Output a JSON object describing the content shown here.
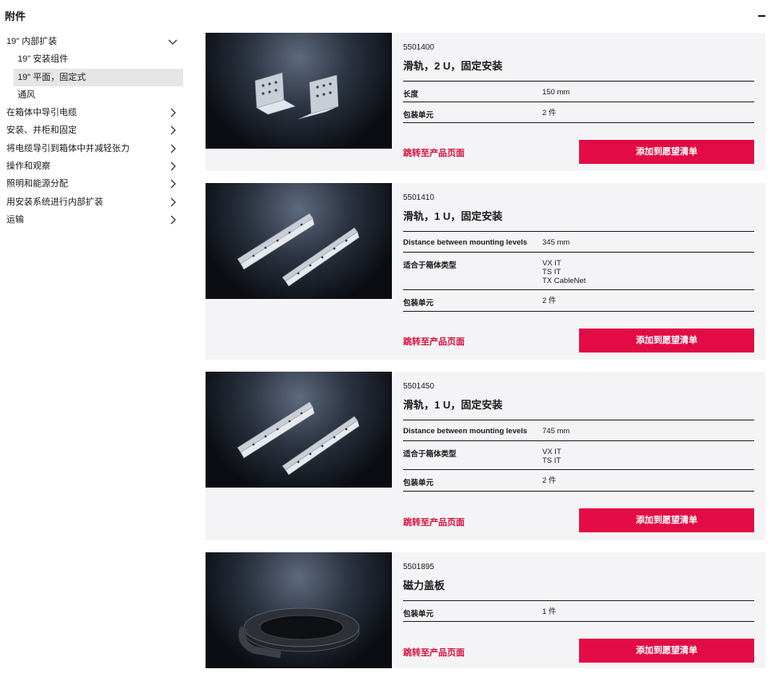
{
  "header": {
    "title": "附件"
  },
  "sidebar": {
    "items": [
      {
        "label": "19\" 内部扩装"
      },
      {
        "label": "19\" 安装组件"
      },
      {
        "label": "19\" 平面，固定式"
      },
      {
        "label": "通风"
      },
      {
        "label": "在箱体中导引电缆"
      },
      {
        "label": "安装、并柜和固定"
      },
      {
        "label": "将电缆导引到箱体中并减轻张力"
      },
      {
        "label": "操作和观察"
      },
      {
        "label": "照明和能源分配"
      },
      {
        "label": "用安装系统进行内部扩装"
      },
      {
        "label": "运输"
      }
    ]
  },
  "products": [
    {
      "sku": "5501400",
      "title": "滑轨，2 U，固定安装",
      "specs": [
        {
          "label": "长度",
          "value": "150 mm"
        },
        {
          "label": "包装单元",
          "value": "2 件"
        }
      ],
      "link": "跳转至产品页面",
      "button": "添加到愿望清单"
    },
    {
      "sku": "5501410",
      "title": "滑轨，1 U，固定安装",
      "specs": [
        {
          "label": "Distance between mounting levels",
          "value": "345 mm"
        },
        {
          "label": "适合于箱体类型",
          "value": "VX IT\nTS IT\nTX CableNet"
        },
        {
          "label": "包装单元",
          "value": "2 件"
        }
      ],
      "link": "跳转至产品页面",
      "button": "添加到愿望清单"
    },
    {
      "sku": "5501450",
      "title": "滑轨，1 U，固定安装",
      "specs": [
        {
          "label": "Distance between mounting levels",
          "value": "745 mm"
        },
        {
          "label": "适合于箱体类型",
          "value": "VX IT\nTS IT"
        },
        {
          "label": "包装单元",
          "value": "2 件"
        }
      ],
      "link": "跳转至产品页面",
      "button": "添加到愿望清单"
    },
    {
      "sku": "5501895",
      "title": "磁力盖板",
      "specs": [
        {
          "label": "包装单元",
          "value": "1 件"
        }
      ],
      "link": "跳转至产品页面",
      "button": "添加到愿望清单"
    }
  ],
  "colors": {
    "accent": "#e30b45",
    "link": "#d80f3d",
    "card_bg": "#f4f4f6",
    "active_bg": "#e6e6e6"
  }
}
